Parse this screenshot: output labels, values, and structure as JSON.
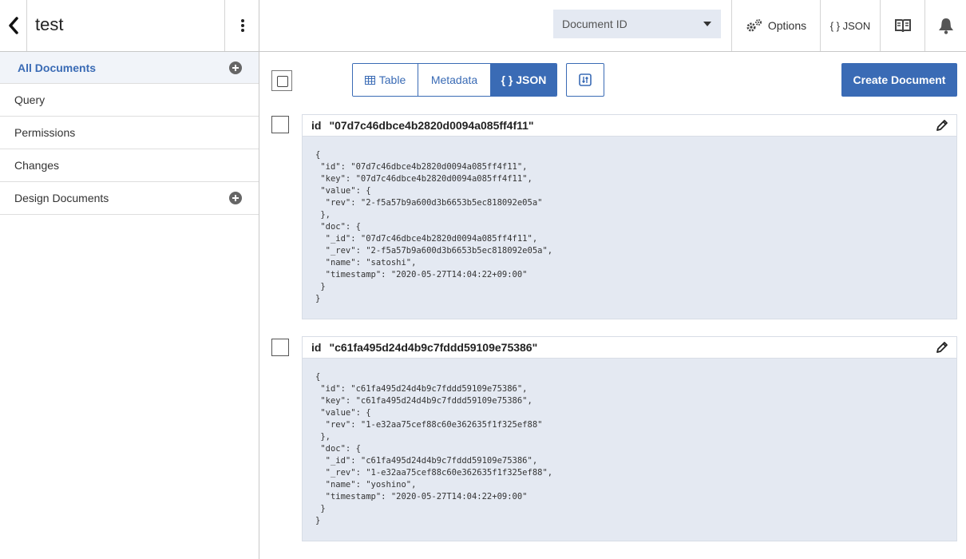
{
  "header": {
    "database_name": "test",
    "doc_id_select": "Document ID",
    "options_label": "Options",
    "json_label": "{ } JSON"
  },
  "sidebar": {
    "items": [
      {
        "label": "All Documents",
        "active": true,
        "has_add": true
      },
      {
        "label": "Query",
        "active": false,
        "has_add": false
      },
      {
        "label": "Permissions",
        "active": false,
        "has_add": false
      },
      {
        "label": "Changes",
        "active": false,
        "has_add": false
      },
      {
        "label": "Design Documents",
        "active": false,
        "has_add": true
      }
    ]
  },
  "toolbar": {
    "view_table": "Table",
    "view_metadata": "Metadata",
    "view_json": "{ } JSON",
    "create_document": "Create Document"
  },
  "documents": [
    {
      "id_label": "id",
      "id_value": "\"07d7c46dbce4b2820d0094a085ff4f11\"",
      "json": "{\n \"id\": \"07d7c46dbce4b2820d0094a085ff4f11\",\n \"key\": \"07d7c46dbce4b2820d0094a085ff4f11\",\n \"value\": {\n  \"rev\": \"2-f5a57b9a600d3b6653b5ec818092e05a\"\n },\n \"doc\": {\n  \"_id\": \"07d7c46dbce4b2820d0094a085ff4f11\",\n  \"_rev\": \"2-f5a57b9a600d3b6653b5ec818092e05a\",\n  \"name\": \"satoshi\",\n  \"timestamp\": \"2020-05-27T14:04:22+09:00\"\n }\n}"
    },
    {
      "id_label": "id",
      "id_value": "\"c61fa495d24d4b9c7fddd59109e75386\"",
      "json": "{\n \"id\": \"c61fa495d24d4b9c7fddd59109e75386\",\n \"key\": \"c61fa495d24d4b9c7fddd59109e75386\",\n \"value\": {\n  \"rev\": \"1-e32aa75cef88c60e362635f1f325ef88\"\n },\n \"doc\": {\n  \"_id\": \"c61fa495d24d4b9c7fddd59109e75386\",\n  \"_rev\": \"1-e32aa75cef88c60e362635f1f325ef88\",\n  \"name\": \"yoshino\",\n  \"timestamp\": \"2020-05-27T14:04:22+09:00\"\n }\n}"
    }
  ],
  "colors": {
    "accent": "#3a6bb5",
    "panel_bg": "#e4e9f2"
  }
}
